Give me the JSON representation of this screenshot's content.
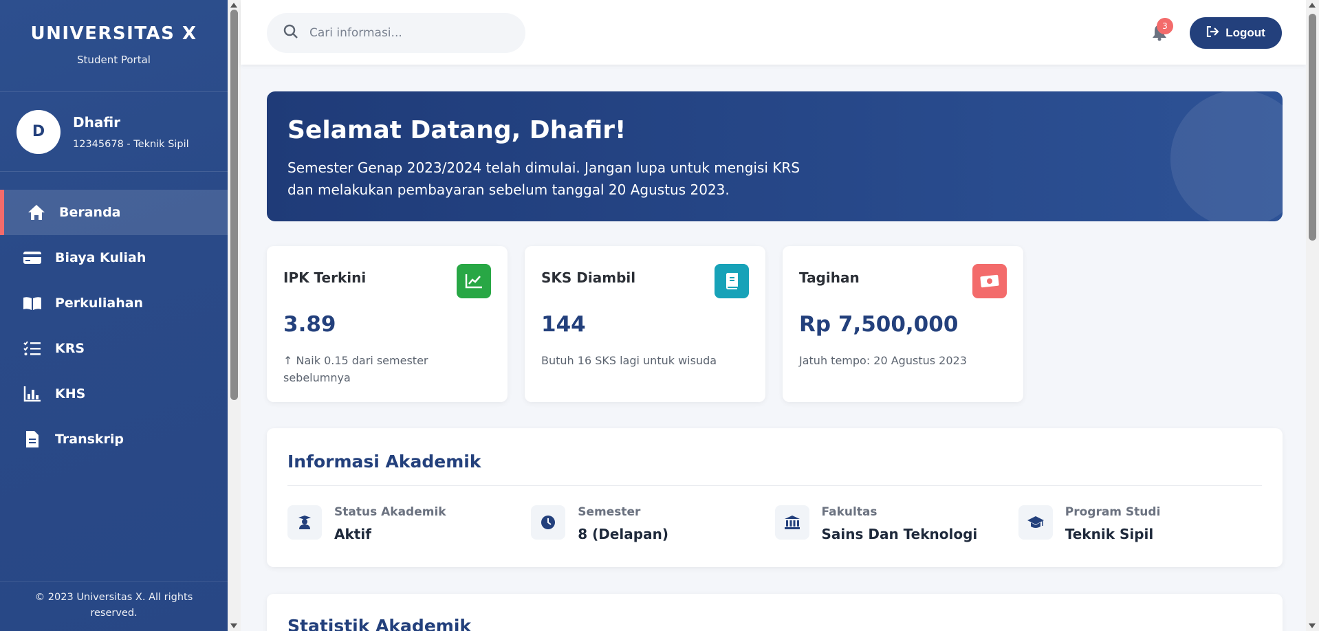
{
  "sidebar": {
    "brand_title": "UNIVERSITAS X",
    "brand_sub": "Student Portal",
    "profile": {
      "initial": "D",
      "name": "Dhafir",
      "meta": "12345678 - Teknik Sipil"
    },
    "items": [
      {
        "label": "Beranda",
        "icon": "home-icon",
        "active": true
      },
      {
        "label": "Biaya Kuliah",
        "icon": "credit-card-icon"
      },
      {
        "label": "Perkuliahan",
        "icon": "book-open-icon"
      },
      {
        "label": "KRS",
        "icon": "checklist-icon"
      },
      {
        "label": "KHS",
        "icon": "bar-chart-icon"
      },
      {
        "label": "Transkrip",
        "icon": "document-icon"
      }
    ],
    "footer": "© 2023 Universitas X. All rights reserved."
  },
  "topbar": {
    "search_placeholder": "Cari informasi...",
    "notification_count": "3",
    "logout_label": "Logout"
  },
  "welcome": {
    "title": "Selamat Datang, Dhafir!",
    "message": "Semester Genap 2023/2024 telah dimulai. Jangan lupa untuk mengisi KRS dan melakukan pembayaran sebelum tanggal 20 Agustus 2023."
  },
  "cards": [
    {
      "title": "IPK Terkini",
      "value": "3.89",
      "note": "↑ Naik 0.15 dari semester sebelumnya",
      "icon": "chart-line-icon",
      "color": "#28a745"
    },
    {
      "title": "SKS Diambil",
      "value": "144",
      "note": "Butuh 16 SKS lagi untuk wisuda",
      "icon": "book-icon",
      "color": "#17a2b8"
    },
    {
      "title": "Tagihan",
      "value": "Rp 7,500,000",
      "note": "Jatuh tempo: 20 Agustus 2023",
      "icon": "money-bill-icon",
      "color": "#f36b6b"
    }
  ],
  "academic": {
    "title": "Informasi Akademik",
    "items": [
      {
        "label": "Status Akademik",
        "value": "Aktif",
        "icon": "user-graduate-icon"
      },
      {
        "label": "Semester",
        "value": "8 (Delapan)",
        "icon": "clock-icon"
      },
      {
        "label": "Fakultas",
        "value": "Sains Dan Teknologi",
        "icon": "university-icon"
      },
      {
        "label": "Program Studi",
        "value": "Teknik Sipil",
        "icon": "graduation-cap-icon"
      }
    ]
  },
  "statistics": {
    "title": "Statistik Akademik"
  },
  "colors": {
    "primary": "#23407c",
    "accent": "#f36b6b"
  }
}
